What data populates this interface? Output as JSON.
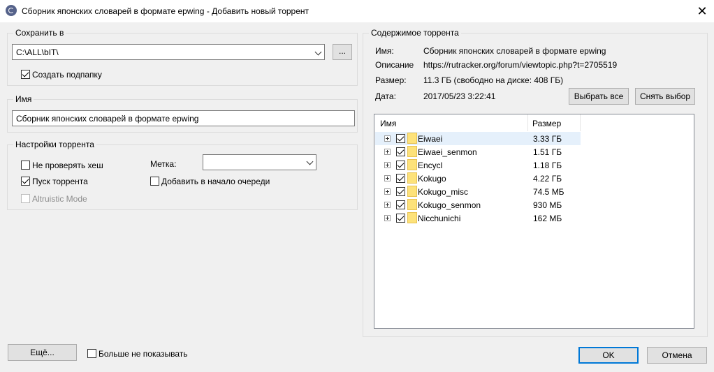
{
  "window": {
    "title": "Сборник японских словарей в формате epwing - Добавить новый торрент",
    "close_glyph": "✕"
  },
  "save_to": {
    "group_label": "Сохранить в",
    "path": "C:\\ALL\\bIT\\",
    "browse_label": "...",
    "create_subfolder_label": "Создать подпапку",
    "create_subfolder_checked": true
  },
  "name": {
    "group_label": "Имя",
    "value": "Сборник японских словарей в формате epwing"
  },
  "settings": {
    "group_label": "Настройки торрента",
    "skip_hash_label": "Не проверять хеш",
    "skip_hash_checked": false,
    "start_label": "Пуск торрента",
    "start_checked": true,
    "altruistic_label": "Altruistic Mode",
    "altruistic_checked": false,
    "label_caption": "Метка:",
    "label_value": "",
    "add_to_top_label": "Добавить в начало очереди",
    "add_to_top_checked": false
  },
  "content": {
    "group_label": "Содержимое торрента",
    "name_key": "Имя:",
    "name_value": "Сборник японских словарей в формате epwing",
    "desc_key": "Описание",
    "desc_value": "https://rutracker.org/forum/viewtopic.php?t=2705519",
    "size_key": "Размер:",
    "size_value": "11.3 ГБ (свободно на диске: 408 ГБ)",
    "date_key": "Дата:",
    "date_value": "2017/05/23 3:22:41",
    "select_all_label": "Выбрать все",
    "deselect_label": "Снять выбор",
    "columns": {
      "name": "Имя",
      "size": "Размер"
    },
    "files": [
      {
        "name": "Eiwaei",
        "size": "3.33 ГБ",
        "checked": true,
        "selected": true
      },
      {
        "name": "Eiwaei_senmon",
        "size": "1.51 ГБ",
        "checked": true,
        "selected": false
      },
      {
        "name": "Encycl",
        "size": "1.18 ГБ",
        "checked": true,
        "selected": false
      },
      {
        "name": "Kokugo",
        "size": "4.22 ГБ",
        "checked": true,
        "selected": false
      },
      {
        "name": "Kokugo_misc",
        "size": "74.5 МБ",
        "checked": true,
        "selected": false
      },
      {
        "name": "Kokugo_senmon",
        "size": "930 МБ",
        "checked": true,
        "selected": false
      },
      {
        "name": "Nicchunichi",
        "size": "162 МБ",
        "checked": true,
        "selected": false
      }
    ]
  },
  "footer": {
    "more_label": "Ещё...",
    "dont_show_label": "Больше не показывать",
    "dont_show_checked": false,
    "ok_label": "OK",
    "cancel_label": "Отмена"
  },
  "colors": {
    "accent": "#0078d7",
    "selection": "#e5f0fb",
    "folder": "#fde27a"
  }
}
